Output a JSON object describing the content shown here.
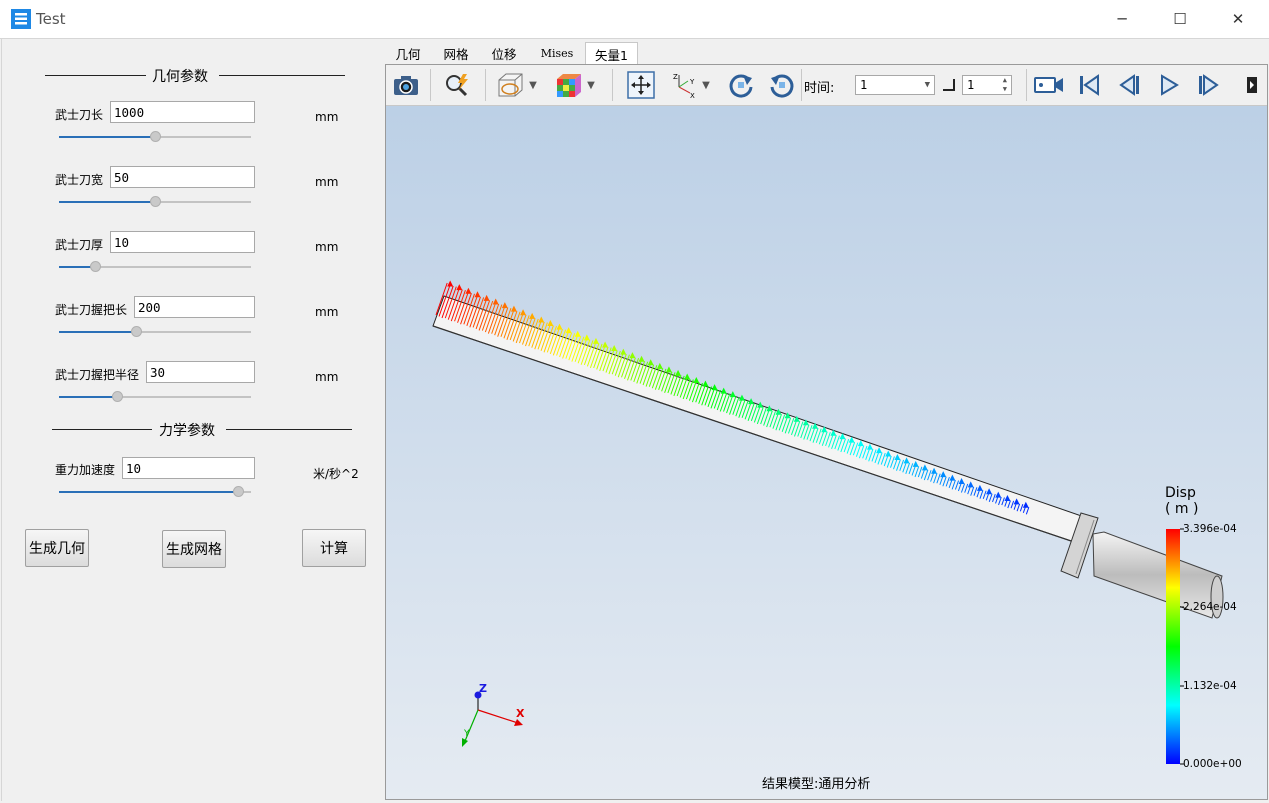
{
  "window": {
    "title": "Test",
    "minimize_glyph": "─",
    "maximize_glyph": "☐",
    "close_glyph": "✕"
  },
  "left_panel": {
    "geometry_section": "几何参数",
    "mechanics_section": "力学参数",
    "params": [
      {
        "label": "武士刀长",
        "value": "1000",
        "unit": "mm",
        "slider": 0.5
      },
      {
        "label": "武士刀宽",
        "value": "50",
        "unit": "mm",
        "slider": 0.5
      },
      {
        "label": "武士刀厚",
        "value": "10",
        "unit": "mm",
        "slider": 0.19
      },
      {
        "label": "武士刀握把长",
        "value": "200",
        "unit": "mm",
        "slider": 0.4
      },
      {
        "label": "武士刀握把半径",
        "value": "30",
        "unit": "mm",
        "slider": 0.3
      }
    ],
    "gravity": {
      "label": "重力加速度",
      "value": "10",
      "unit": "米/秒^2",
      "slider": 0.93
    },
    "buttons": {
      "generate_geometry": "生成几何",
      "generate_mesh": "生成网格",
      "compute": "计算"
    }
  },
  "tabs": [
    {
      "label": "几何",
      "active": false
    },
    {
      "label": "网格",
      "active": false
    },
    {
      "label": "位移",
      "active": false
    },
    {
      "label": "Mises",
      "active": false
    },
    {
      "label": "矢量1",
      "active": true
    }
  ],
  "toolbar": {
    "time_label": "时间:",
    "time_value": "1",
    "step_value": "1",
    "icons": [
      "camera-icon",
      "zoom-icon",
      "view-mode-icon",
      "color-cube-icon",
      "fit-view-icon",
      "axes-icon",
      "rotate-cw-icon",
      "rotate-ccw-icon",
      "record-icon",
      "first-frame-icon",
      "prev-frame-icon",
      "play-icon",
      "next-frame-icon",
      "more-icon"
    ]
  },
  "viewport": {
    "legend_title": "Disp",
    "legend_unit": "( m )",
    "legend_ticks": [
      "3.396e-04",
      "2.264e-04",
      "1.132e-04",
      "0.000e+00"
    ],
    "footer": "结果模型:通用分析",
    "axes": {
      "z": "Z",
      "x": "X",
      "y": "Y"
    },
    "colors": {
      "max": "#ff0000",
      "mid_high": "#ffff00",
      "mid": "#00ff00",
      "mid_low": "#00ffff",
      "min": "#0000ff"
    }
  }
}
